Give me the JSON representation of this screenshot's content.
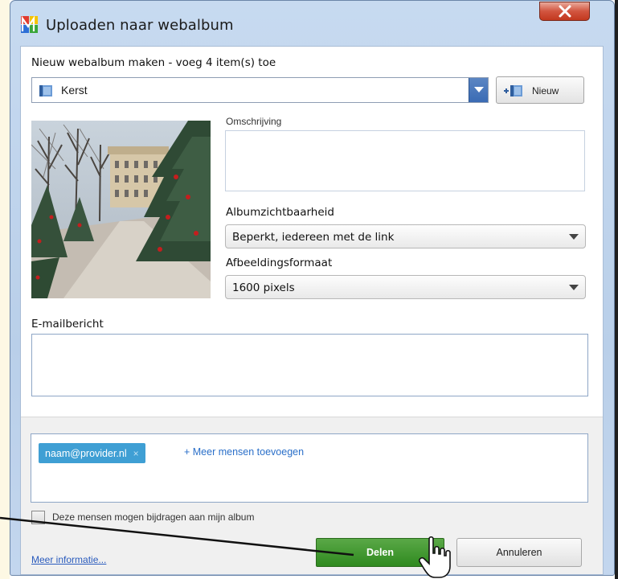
{
  "window": {
    "title": "Uploaden naar webalbum",
    "close_symbol": "X"
  },
  "header": {
    "instruction": "Nieuw webalbum maken - voeg 4 item(s) toe"
  },
  "album": {
    "selected": "Kerst",
    "new_button_label": "Nieuw",
    "icon": "album-book-icon"
  },
  "details": {
    "description_label": "Omschrijving",
    "description_value": "",
    "visibility_label": "Albumzichtbaarheid",
    "visibility_value": "Beperkt, iedereen met de link",
    "size_label": "Afbeeldingsformaat",
    "size_value": "1600 pixels"
  },
  "email": {
    "label": "E-mailbericht",
    "value": ""
  },
  "recipients": {
    "chips": [
      "naam@provider.nl"
    ],
    "chip_remove": "×",
    "add_more": "+ Meer mensen toevoegen"
  },
  "contribute": {
    "label": "Deze mensen mogen bijdragen aan mijn album",
    "checked": false
  },
  "footer": {
    "more_info": "Meer informatie...",
    "share": "Delen",
    "cancel": "Annuleren"
  },
  "colors": {
    "share_green": "#3a9a2a",
    "chip_blue": "#3f9fd4",
    "link_blue": "#2a6fc9",
    "close_red": "#c9452b"
  }
}
